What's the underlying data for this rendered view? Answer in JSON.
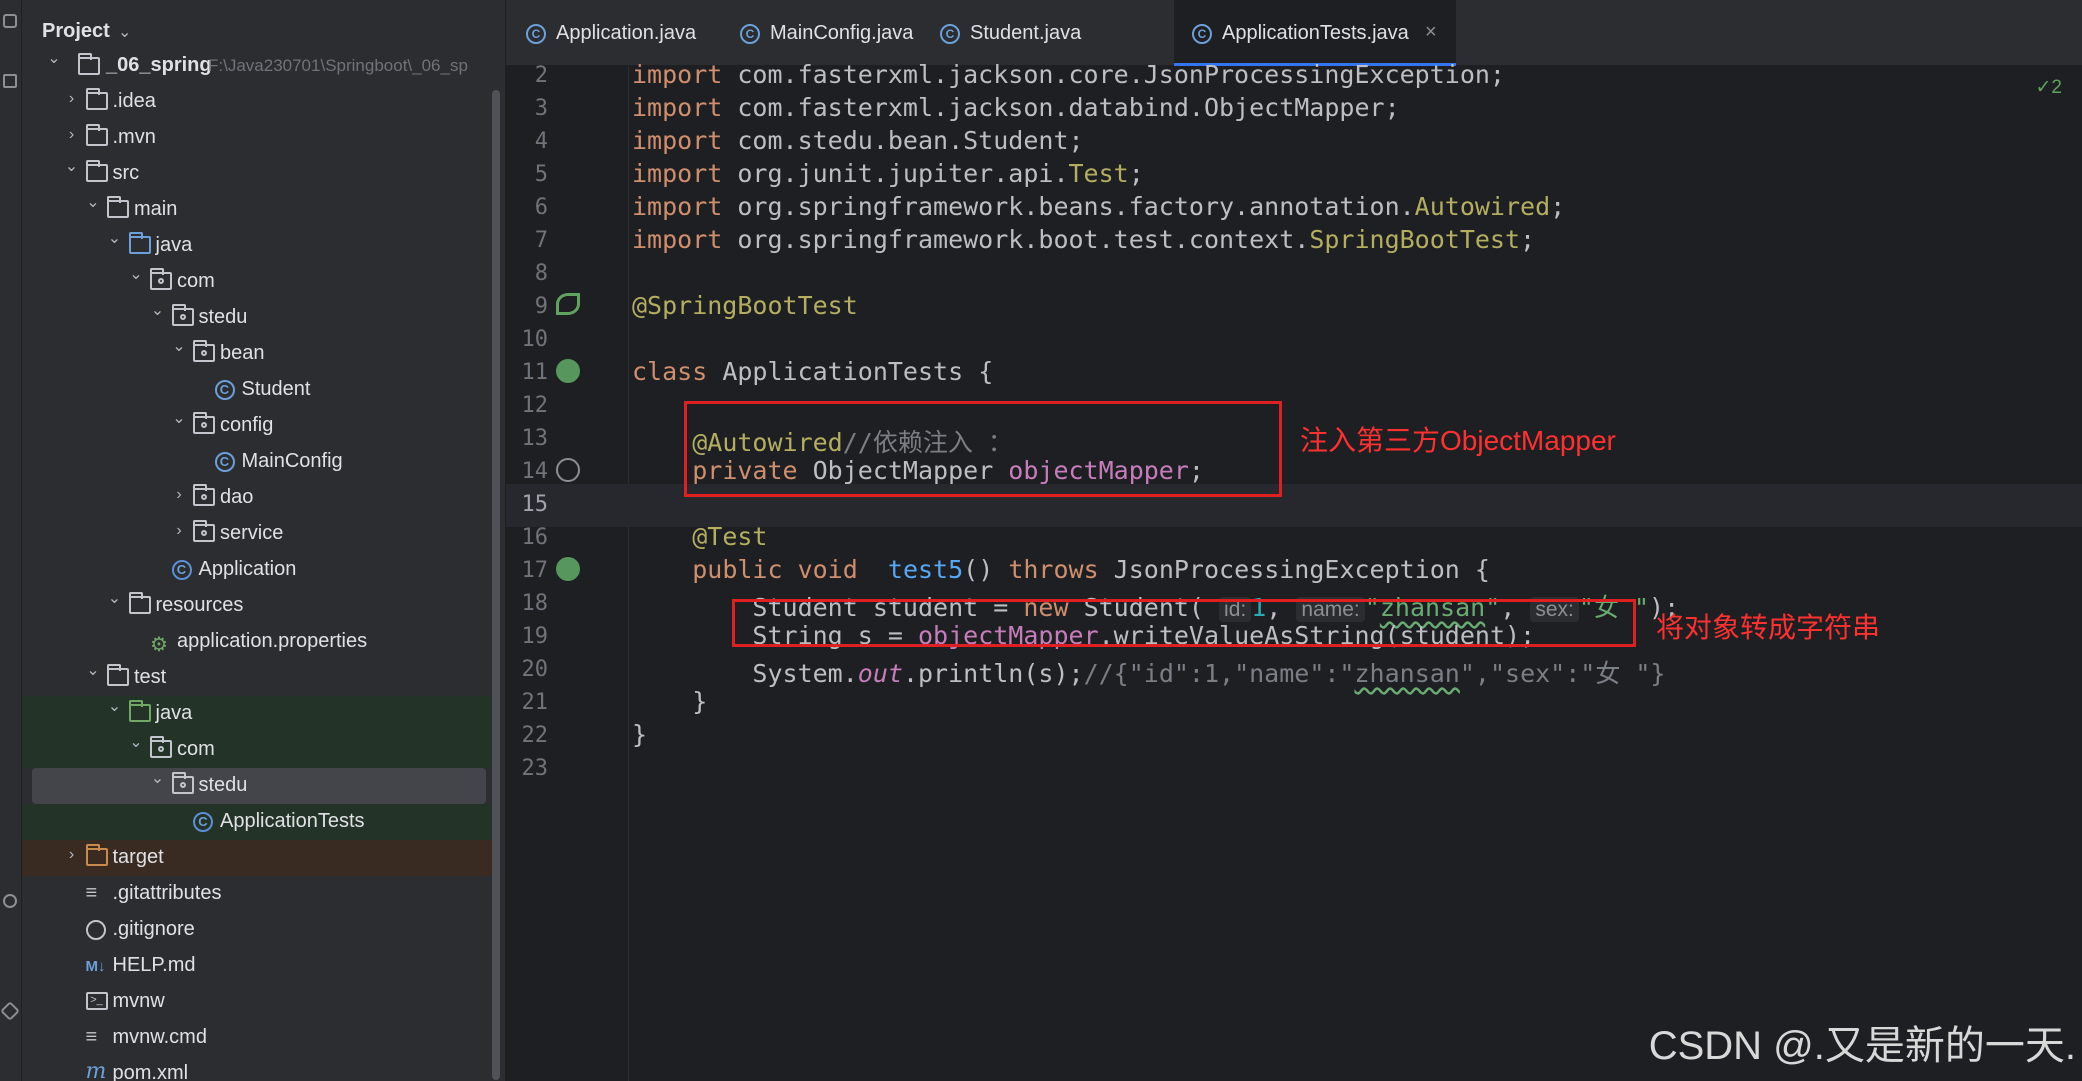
{
  "project": {
    "title": "Project",
    "root_name": "_06_spring",
    "root_path": "F:\\Java230701\\Springboot\\_06_sp",
    "tree": [
      {
        "label": ".idea",
        "kind": "folder",
        "chevron": "›"
      },
      {
        "label": ".mvn",
        "kind": "folder",
        "chevron": "›"
      },
      {
        "label": "src",
        "kind": "folder",
        "chevron": "⌄"
      },
      {
        "label": "main",
        "kind": "folder",
        "chevron": "⌄"
      },
      {
        "label": "java",
        "kind": "folder-blue",
        "chevron": "⌄"
      },
      {
        "label": "com",
        "kind": "package",
        "chevron": "⌄"
      },
      {
        "label": "stedu",
        "kind": "package",
        "chevron": "⌄"
      },
      {
        "label": "bean",
        "kind": "package",
        "chevron": "⌄"
      },
      {
        "label": "Student",
        "kind": "class"
      },
      {
        "label": "config",
        "kind": "package",
        "chevron": "⌄"
      },
      {
        "label": "MainConfig",
        "kind": "class"
      },
      {
        "label": "dao",
        "kind": "package",
        "chevron": "›"
      },
      {
        "label": "service",
        "kind": "package",
        "chevron": "›"
      },
      {
        "label": "Application",
        "kind": "class-app"
      },
      {
        "label": "resources",
        "kind": "folder-res",
        "chevron": "⌄"
      },
      {
        "label": "application.properties",
        "kind": "props"
      },
      {
        "label": "test",
        "kind": "folder",
        "chevron": "⌄"
      },
      {
        "label": "java",
        "kind": "folder-green",
        "chevron": "⌄"
      },
      {
        "label": "com",
        "kind": "package",
        "chevron": "⌄"
      },
      {
        "label": "stedu",
        "kind": "package",
        "chevron": "⌄"
      },
      {
        "label": "ApplicationTests",
        "kind": "class-app"
      },
      {
        "label": "target",
        "kind": "folder-orange",
        "chevron": "›"
      },
      {
        "label": ".gitattributes",
        "kind": "text"
      },
      {
        "label": ".gitignore",
        "kind": "ignore"
      },
      {
        "label": "HELP.md",
        "kind": "md"
      },
      {
        "label": "mvnw",
        "kind": "terminal"
      },
      {
        "label": "mvnw.cmd",
        "kind": "text"
      },
      {
        "label": "pom.xml",
        "kind": "maven"
      }
    ]
  },
  "tabs": [
    {
      "label": "Application.java",
      "icon": "class-icon"
    },
    {
      "label": "MainConfig.java",
      "icon": "class-icon"
    },
    {
      "label": "Student.java",
      "icon": "class-icon"
    },
    {
      "label": "ApplicationTests.java",
      "icon": "class-icon",
      "active": true,
      "close": "×"
    }
  ],
  "editor": {
    "inspections": "✓2",
    "lines": [
      {
        "n": "2",
        "text": "import com.fasterxml.jackson.core.JsonProcessingException;"
      },
      {
        "n": "3",
        "text": "import com.fasterxml.jackson.databind.ObjectMapper;"
      },
      {
        "n": "4",
        "text": "import com.stedu.bean.Student;"
      },
      {
        "n": "5",
        "text": "import org.junit.jupiter.api.Test;"
      },
      {
        "n": "6",
        "text": "import org.springframework.beans.factory.annotation.Autowired;"
      },
      {
        "n": "7",
        "text": "import org.springframework.boot.test.context.SpringBootTest;"
      },
      {
        "n": "8",
        "text": ""
      },
      {
        "n": "9",
        "text": "@SpringBootTest"
      },
      {
        "n": "10",
        "text": ""
      },
      {
        "n": "11",
        "text": "class ApplicationTests {"
      },
      {
        "n": "12",
        "text": ""
      },
      {
        "n": "13",
        "text": "    @Autowired//依赖注入 ："
      },
      {
        "n": "14",
        "text": "    private ObjectMapper objectMapper;"
      },
      {
        "n": "15",
        "text": ""
      },
      {
        "n": "16",
        "text": "    @Test"
      },
      {
        "n": "17",
        "text": "    public void  test5() throws JsonProcessingException {"
      },
      {
        "n": "18",
        "text": "        Student student = new Student( id: 1,  name: \"zhansan\",  sex: \"女 \");"
      },
      {
        "n": "19",
        "text": "        String s = objectMapper.writeValueAsString(student);"
      },
      {
        "n": "20",
        "text": "        System.out.println(s);//{\"id\":1,\"name\":\"zhansan\",\"sex\":\"女 \"}"
      },
      {
        "n": "21",
        "text": "    }"
      },
      {
        "n": "22",
        "text": "}"
      },
      {
        "n": "23",
        "text": ""
      }
    ],
    "tokens": {
      "import_kw": "import",
      "l2_pkg": " com.fasterxml.jackson.core.JsonProcessingException;",
      "l3_pkg": " com.fasterxml.jackson.databind.ObjectMapper;",
      "l4_pkg": " com.stedu.bean.Student;",
      "l5_pkg": " org.junit.jupiter.api.",
      "l5_cls": "Test",
      "l6_pkg": " org.springframework.beans.factory.annotation.",
      "l6_cls": "Autowired",
      "l7_pkg": " org.springframework.boot.test.context.",
      "l7_cls": "SpringBootTest",
      "semi": ";",
      "ann_sbt": "@SpringBootTest",
      "class_kw": "class",
      "class_name": " ApplicationTests {",
      "ann_autowired": "@Autowired",
      "autowired_comment": "//依赖注入 ：",
      "private_kw": "private",
      "field_type": " ObjectMapper ",
      "field_name": "objectMapper",
      "ann_test": "@Test",
      "public_kw": "public",
      "void_kw": " void",
      "method_name": "  test5",
      "method_paren": "() ",
      "throws_kw": "throws",
      "exception": " JsonProcessingException {",
      "l18_a": "Student student = ",
      "new_kw": "new",
      "l18_b": " Student(",
      "hint_id": "id:",
      "val_id": "1",
      "comma": ", ",
      "hint_name": "name:",
      "val_name_q1": "\"",
      "val_name": "zhansan",
      "val_name_q2": "\"",
      "hint_sex": "sex:",
      "val_sex": "\"女 \"",
      "l18_end": ");",
      "l19_a": "String s = ",
      "l19_field": "objectMapper",
      "l19_b": ".writeValueAsString(student);",
      "l20_a": "System.",
      "l20_out": "out",
      "l20_b": ".println(s);",
      "l20_cmt_a": "//{\"id\":1,\"name\":\"",
      "l20_cmt_name": "zhansan",
      "l20_cmt_b": "\",\"sex\":\"女 \"}",
      "close_method": "}",
      "close_class": "}"
    }
  },
  "annotations": {
    "inject_note": "注入第三方ObjectMapper",
    "convert_note": "将对象转成字符串"
  },
  "watermark": "CSDN @.又是新的一天.",
  "colors": {
    "background": "#1e1f22",
    "panel": "#2b2d30",
    "keyword": "#cf8e6d",
    "annotation": "#b3ae60",
    "field": "#c77dbb",
    "method": "#56a8f5",
    "string": "#6aab73",
    "number": "#2aacb8",
    "callout_red": "#e02020"
  }
}
